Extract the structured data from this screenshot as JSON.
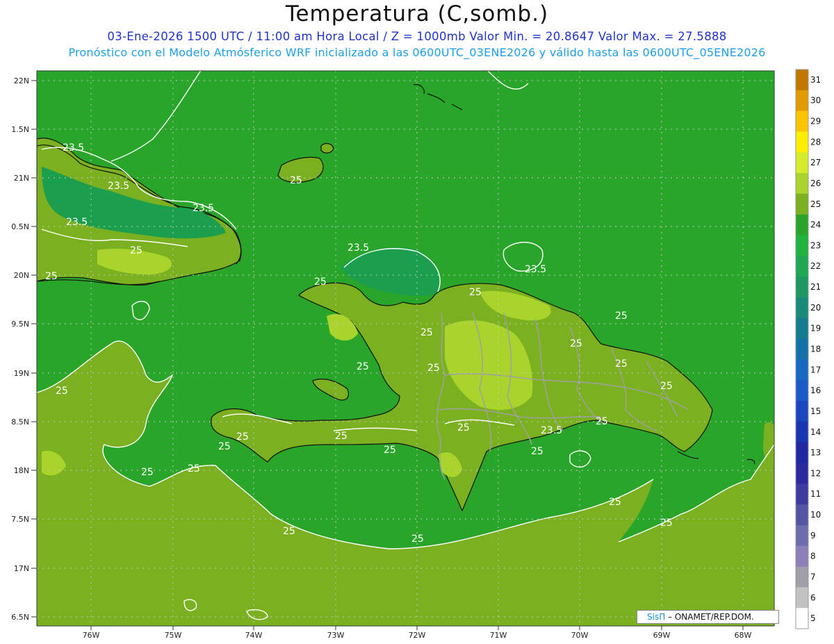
{
  "title": "Temperatura (C,somb.)",
  "subtitle_line1": "03-Ene-2026 1500 UTC / 11:00 am Hora Local / Z = 1000mb   Valor Min. = 20.8647   Valor Max. = 27.5888",
  "subtitle_line2": "Pronóstico con el Modelo Atmósferico WRF inicializado a las 0600UTC_03ENE2026 y válido hasta las  0600UTC_05ENE2026",
  "credit": {
    "brand": "SisΠ",
    "text": " – ONAMET/REP.DOM."
  },
  "axes": {
    "lat_labels": [
      "22N",
      "1.5N",
      "21N",
      "0.5N",
      "20N",
      "9.5N",
      "19N",
      "8.5N",
      "18N",
      "7.5N",
      "17N",
      "6.5N"
    ],
    "lon_labels": [
      "76W",
      "75W",
      "74W",
      "73W",
      "72W",
      "71W",
      "70W",
      "69W",
      "68W"
    ]
  },
  "contour_labels": [
    "23.5",
    "25"
  ],
  "colorbar": {
    "levels": [
      "31",
      "30",
      "29",
      "28",
      "27",
      "26",
      "25",
      "24",
      "23",
      "22",
      "21",
      "20",
      "19",
      "18",
      "17",
      "16",
      "15",
      "14",
      "13",
      "12",
      "11",
      "10",
      "9",
      "8",
      "7",
      "6",
      "5"
    ],
    "colors": [
      "#c07800",
      "#e39a00",
      "#ffc400",
      "#ffee00",
      "#d4ec2a",
      "#a8d42b",
      "#7bb020",
      "#29a52a",
      "#1fb43e",
      "#1ea853",
      "#1a9a62",
      "#168b78",
      "#147c8f",
      "#1470a8",
      "#1768c4",
      "#1a5bc9",
      "#1a46bf",
      "#1a35b2",
      "#1f27a3",
      "#2a2a9e",
      "#3c3c9e",
      "#5454a6",
      "#6c6cae",
      "#8d80b8",
      "#a0a0a8",
      "#c2c2c2",
      "#ffffff"
    ]
  },
  "colors": {
    "ocean": "#29a52a",
    "ocean_cool": "#1b9e4e",
    "land": "#7bb020",
    "land_warm": "#a8d42b",
    "contour": "#ffffff",
    "coast": "#111111",
    "borders": "#a0a0a0"
  }
}
